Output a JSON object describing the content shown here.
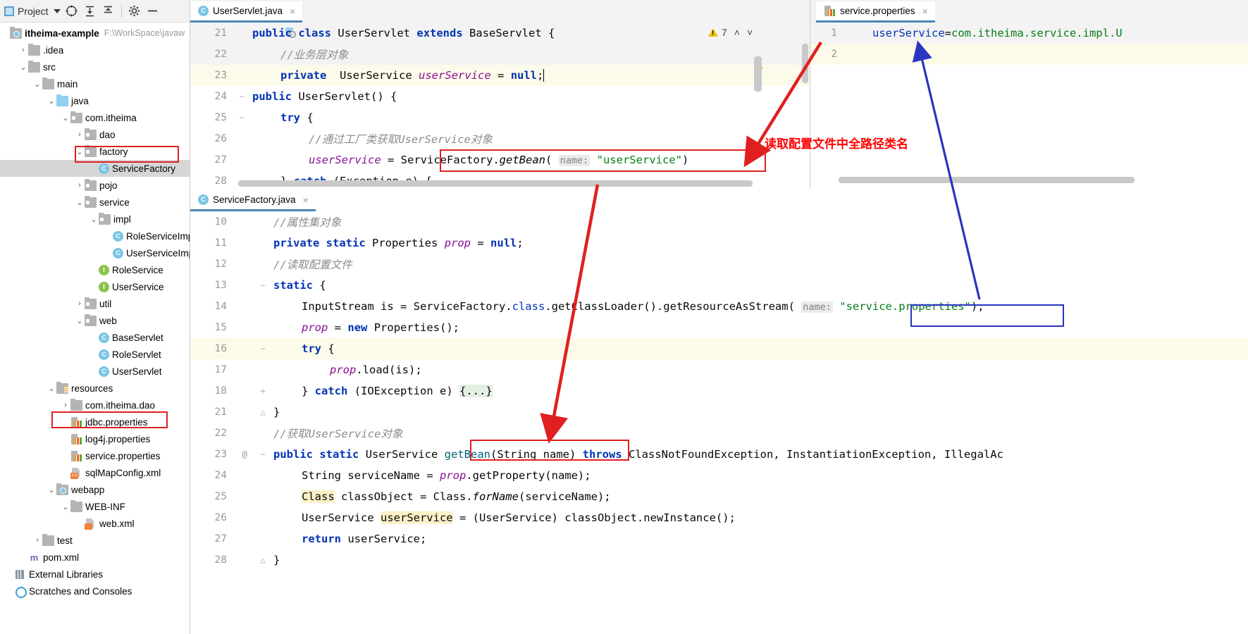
{
  "project_panel": {
    "toolbar": {
      "title": "Project",
      "icons": [
        "locate-icon",
        "expand-all-icon",
        "collapse-all-icon",
        "gear-icon",
        "hide-icon"
      ]
    },
    "root": {
      "label": "itheima-example",
      "path": "F:\\WorkSpace\\javaw"
    },
    "items": [
      {
        "label": ".idea",
        "indent": 1,
        "arrow": ">",
        "icon": "folder-grey"
      },
      {
        "label": "src",
        "indent": 1,
        "arrow": "v",
        "icon": "folder-grey"
      },
      {
        "label": "main",
        "indent": 2,
        "arrow": "v",
        "icon": "folder-grey"
      },
      {
        "label": "java",
        "indent": 3,
        "arrow": "v",
        "icon": "folder-blue"
      },
      {
        "label": "com.itheima",
        "indent": 4,
        "arrow": "v",
        "icon": "folder-pkg"
      },
      {
        "label": "dao",
        "indent": 5,
        "arrow": ">",
        "icon": "folder-pkg"
      },
      {
        "label": "factory",
        "indent": 5,
        "arrow": "v",
        "icon": "folder-pkg"
      },
      {
        "label": "ServiceFactory",
        "indent": 6,
        "arrow": "",
        "icon": "class-icon",
        "selected": true,
        "highlight": true
      },
      {
        "label": "pojo",
        "indent": 5,
        "arrow": ">",
        "icon": "folder-pkg"
      },
      {
        "label": "service",
        "indent": 5,
        "arrow": "v",
        "icon": "folder-pkg"
      },
      {
        "label": "impl",
        "indent": 6,
        "arrow": "v",
        "icon": "folder-pkg"
      },
      {
        "label": "RoleServiceImpl",
        "indent": 7,
        "arrow": "",
        "icon": "class-icon"
      },
      {
        "label": "UserServiceImpl",
        "indent": 7,
        "arrow": "",
        "icon": "class-icon"
      },
      {
        "label": "RoleService",
        "indent": 6,
        "arrow": "",
        "icon": "interface-icon"
      },
      {
        "label": "UserService",
        "indent": 6,
        "arrow": "",
        "icon": "interface-icon"
      },
      {
        "label": "util",
        "indent": 5,
        "arrow": ">",
        "icon": "folder-pkg"
      },
      {
        "label": "web",
        "indent": 5,
        "arrow": "v",
        "icon": "folder-pkg"
      },
      {
        "label": "BaseServlet",
        "indent": 6,
        "arrow": "",
        "icon": "class-icon"
      },
      {
        "label": "RoleServlet",
        "indent": 6,
        "arrow": "",
        "icon": "class-icon"
      },
      {
        "label": "UserServlet",
        "indent": 6,
        "arrow": "",
        "icon": "class-icon"
      },
      {
        "label": "resources",
        "indent": 3,
        "arrow": "v",
        "icon": "folder-resources"
      },
      {
        "label": "com.itheima.dao",
        "indent": 4,
        "arrow": ">",
        "icon": "folder-grey"
      },
      {
        "label": "jdbc.properties",
        "indent": 4,
        "arrow": "",
        "icon": "properties-icon"
      },
      {
        "label": "log4j.properties",
        "indent": 4,
        "arrow": "",
        "icon": "properties-icon"
      },
      {
        "label": "service.properties",
        "indent": 4,
        "arrow": "",
        "icon": "properties-icon",
        "highlight": true
      },
      {
        "label": "sqlMapConfig.xml",
        "indent": 4,
        "arrow": "",
        "icon": "xml-icon"
      },
      {
        "label": "webapp",
        "indent": 3,
        "arrow": "v",
        "icon": "folder-webapp"
      },
      {
        "label": "WEB-INF",
        "indent": 4,
        "arrow": "v",
        "icon": "folder-grey"
      },
      {
        "label": "web.xml",
        "indent": 5,
        "arrow": "",
        "icon": "xml-web-icon"
      },
      {
        "label": "test",
        "indent": 2,
        "arrow": ">",
        "icon": "folder-grey"
      },
      {
        "label": "pom.xml",
        "indent": 1,
        "arrow": "",
        "icon": "maven-icon"
      },
      {
        "label": "External Libraries",
        "indent": 0,
        "arrow": "",
        "icon": "library-icon"
      },
      {
        "label": "Scratches and Consoles",
        "indent": 0,
        "arrow": "",
        "icon": "scratch-icon"
      }
    ]
  },
  "editor_top": {
    "tab": {
      "label": "UserServlet.java",
      "icon": "class-icon",
      "close": "×"
    },
    "inspection": {
      "icon": "warning-icon",
      "count": "7",
      "up": "˄",
      "down": "˅"
    },
    "lines": [
      {
        "num": "21",
        "gutterIcon": "override-icon",
        "state": "cur"
      },
      {
        "num": "22",
        "state": "cur"
      },
      {
        "num": "23",
        "state": "hl"
      },
      {
        "num": "24",
        "fold": "−"
      },
      {
        "num": "25",
        "fold": "−"
      },
      {
        "num": "26"
      },
      {
        "num": "27"
      },
      {
        "num": "28",
        "fold": "−"
      }
    ],
    "code": {
      "l21": "public class UserServlet extends BaseServlet {",
      "l22": "//业务层对象",
      "l23": "private  UserService userService = null;",
      "l24": "public UserServlet() {",
      "l25": "try {",
      "l26": "//通过工厂类获取UserService对象",
      "l27_pre": "userService = ",
      "l27_boxed": "ServiceFactory.getBean(",
      "l27_hint": "name:",
      "l27_str": "\"userService\"",
      "l27_close": ")",
      "l28": "} catch (Exception e) {"
    }
  },
  "editor_mid": {
    "tab": {
      "label": "ServiceFactory.java",
      "icon": "class-icon",
      "close": "×"
    },
    "lines": [
      {
        "num": "10"
      },
      {
        "num": "11"
      },
      {
        "num": "12"
      },
      {
        "num": "13",
        "fold": "−"
      },
      {
        "num": "14"
      },
      {
        "num": "15"
      },
      {
        "num": "16",
        "fold": "−",
        "state": "hl"
      },
      {
        "num": "17"
      },
      {
        "num": "18",
        "fold": "+"
      },
      {
        "num": "21",
        "fold": "−"
      },
      {
        "num": "22"
      },
      {
        "num": "23",
        "fold": "−",
        "at": "@"
      },
      {
        "num": "24"
      },
      {
        "num": "25"
      },
      {
        "num": "26"
      },
      {
        "num": "27"
      },
      {
        "num": "28"
      }
    ],
    "code": {
      "l10": "//属性集对象",
      "l11": "private static Properties prop = null;",
      "l12": "//读取配置文件",
      "l13": "static {",
      "l14_pre": "InputStream is = ServiceFactory.class.getClassLoader().getResourceAsStream(",
      "l14_hint": "name:",
      "l14_str": "\"service.properties\"",
      "l14_close": ");",
      "l15": "prop = new Properties();",
      "l16": "try {",
      "l17": "prop.load(is);",
      "l18": "} catch (IOException e) {...}",
      "l21": "}",
      "l22": "//获取UserService对象",
      "l23_pre": "public static UserService ",
      "l23_boxed": "getBean(String name)",
      "l23_post": " throws ClassNotFoundException, InstantiationException, IllegalAc",
      "l24": "String serviceName = prop.getProperty(name);",
      "l25": "Class classObject = Class.forName(serviceName);",
      "l26": "UserService userService = (UserService) classObject.newInstance();",
      "l27": "return userService;",
      "l28": "}"
    }
  },
  "right_panel": {
    "tab": {
      "label": "service.properties",
      "icon": "properties-icon",
      "close": "×"
    },
    "lines": [
      {
        "num": "1",
        "state": "cur"
      },
      {
        "num": "2",
        "state": "hl"
      }
    ],
    "code": {
      "l1_key": "userService",
      "l1_eq": "=",
      "l1_val": "com.itheima.service.impl.U"
    }
  },
  "annotations": [
    {
      "name": "read-config-fullpath-note",
      "text": "读取配置文件中全路径类名",
      "color": "#ff0000"
    }
  ],
  "colors": {
    "accent": "#4a86b8",
    "annotation_red": "#e02020",
    "annotation_blue": "#2a35c0",
    "keyword": "#0033b3",
    "string": "#067d17",
    "comment": "#8c8c8c",
    "field": "#871094",
    "selection": "#d6d6d6",
    "highlight_line": "#fcfae8"
  }
}
